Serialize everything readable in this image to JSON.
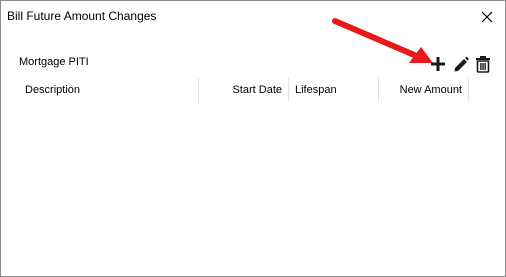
{
  "window": {
    "title": "Bill Future Amount Changes"
  },
  "section": {
    "label": "Mortgage PITI"
  },
  "toolbar": {
    "icons": [
      "add-icon",
      "edit-pencil-icon",
      "delete-trash-icon"
    ]
  },
  "grid": {
    "columns": [
      {
        "label": "Description"
      },
      {
        "label": "Start Date"
      },
      {
        "label": "Lifespan"
      },
      {
        "label": "New Amount"
      }
    ],
    "rows": []
  },
  "colors": {
    "annotation_arrow": "#e8191a",
    "border": "#8c8c8c",
    "icon": "#1a1a1a"
  }
}
